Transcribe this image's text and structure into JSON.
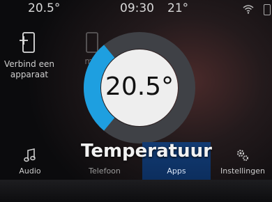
{
  "status": {
    "left_temp": "20.5°",
    "time": "09:30",
    "right_temp": "21°",
    "icons": [
      "wifi-icon",
      "battery-icon"
    ]
  },
  "tiles": {
    "verbind": {
      "label": "Verbind een apparaat",
      "icon": "phone-add-icon"
    },
    "phone2": {
      "icon": "phone-icon",
      "label": "m..."
    }
  },
  "dial": {
    "value": "20.5°",
    "level": 0.28,
    "accent_color": "#1e9fe0",
    "track_color": "#3f4146",
    "face_color": "#eeeeee"
  },
  "title": "Temperatuur",
  "bottom_nav": {
    "audio": {
      "label": "Audio",
      "icon": "music-note-icon"
    },
    "telefoon": {
      "label": "Telefoon"
    },
    "apps": {
      "label": "Apps",
      "active": true
    },
    "instellingen": {
      "label": "Instellingen",
      "icon": "gears-icon"
    }
  }
}
